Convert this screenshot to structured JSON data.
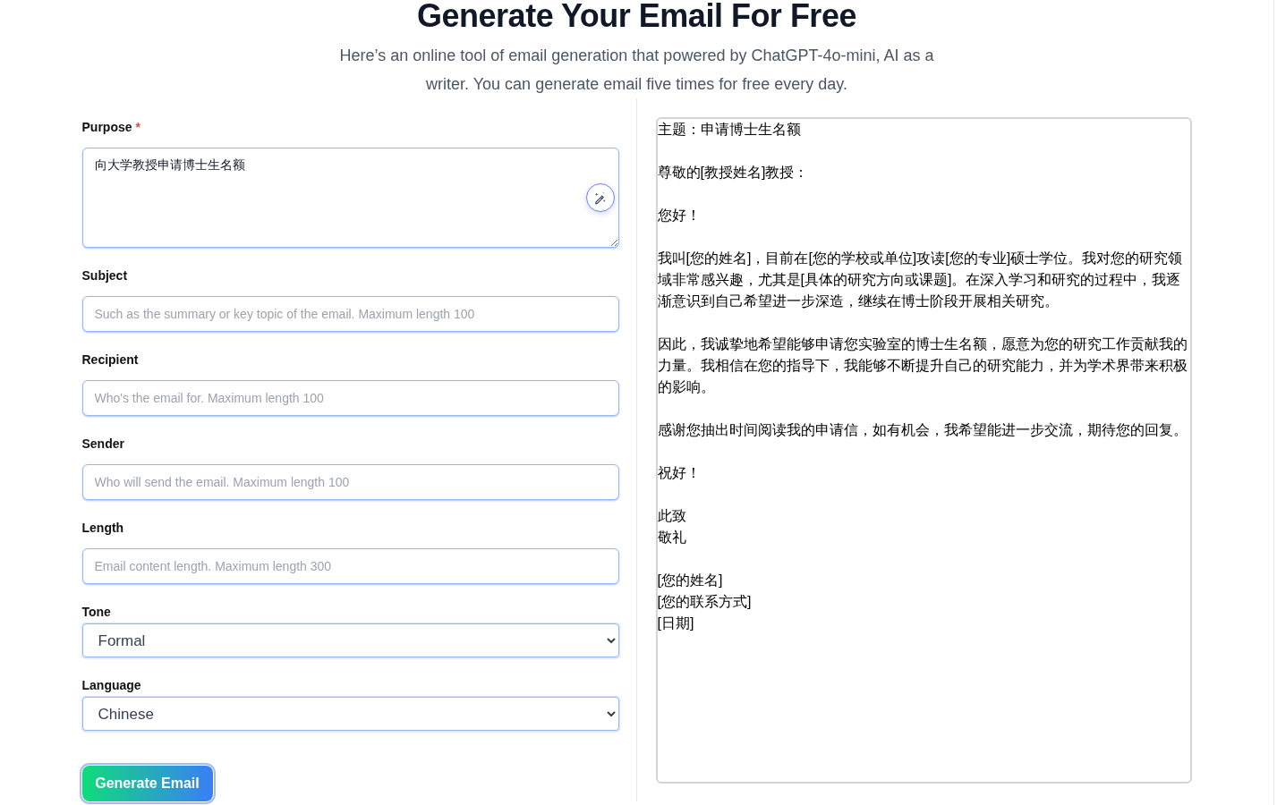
{
  "header": {
    "title": "Generate Your Email For Free",
    "subtitle": "Here’s an online tool of email generation that powered by ChatGPT-4o-mini, AI as a writer. You can generate email five times for free every day."
  },
  "form": {
    "fields": [
      {
        "kind": "textarea",
        "label": "Purpose",
        "required_mark": "*",
        "value": "向大学教授申请博士生名额"
      },
      {
        "kind": "input",
        "label": "Subject",
        "placeholder": "Such as the summary or key topic of the email. Maximum length 100"
      },
      {
        "kind": "input",
        "label": "Recipient",
        "placeholder": "Who's the email for. Maximum length 100"
      },
      {
        "kind": "input",
        "label": "Sender",
        "placeholder": "Who will send the email. Maximum length 100"
      },
      {
        "kind": "input",
        "label": "Length",
        "placeholder": "Email content length. Maximum length 300"
      },
      {
        "kind": "select",
        "label": "Tone",
        "value": "Formal"
      },
      {
        "kind": "select",
        "label": "Language",
        "value": "Chinese"
      }
    ],
    "submit": "Generate Email"
  },
  "output": {
    "paragraphs": [
      [
        "主题：申请博士生名额"
      ],
      [
        "尊敬的[教授姓名]教授："
      ],
      [
        "您好！"
      ],
      [
        "我叫[您的姓名]，目前在[您的学校或单位]攻读[您的专业]硕士学位。我对您的研究领域非常感兴趣，尤其是[具体的研究方向或课题]。在深入学习和研究的过程中，我逐渐意识到自己希望进一步深造，继续在博士阶段开展相关研究。"
      ],
      [
        "因此，我诚挚地希望能够申请您实验室的博士生名额，愿意为您的研究工作贡献我的力量。我相信在您的指导下，我能够不断提升自己的研究能力，并为学术界带来积极的影响。"
      ],
      [
        "感谢您抽出时间阅读我的申请信，如有机会，我希望能进一步交流，期待您的回复。"
      ],
      [
        "祝好！"
      ],
      [
        "此致",
        "敬礼"
      ],
      [
        "[您的姓名]",
        "[您的联系方式]",
        "[日期]"
      ]
    ]
  }
}
